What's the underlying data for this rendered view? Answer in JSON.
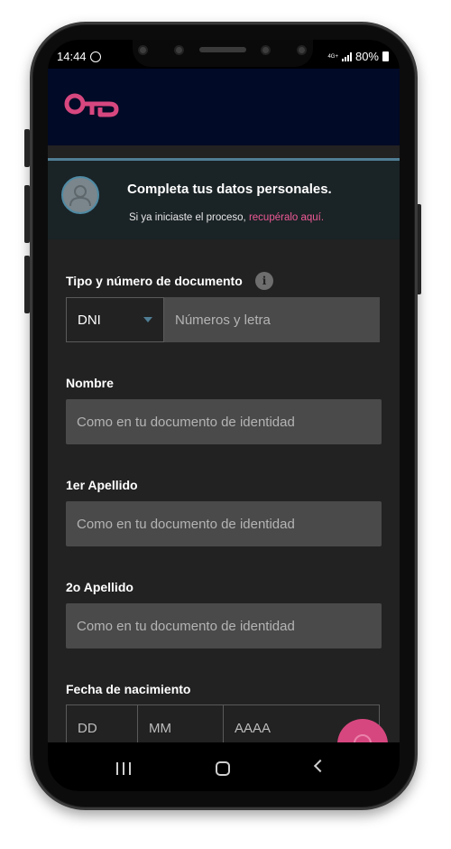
{
  "status": {
    "time": "14:44",
    "network": "4G+",
    "battery": "80%"
  },
  "colors": {
    "header_bg": "#010a26",
    "accent_pink": "#ee5a96",
    "logo": "#d7477f",
    "divider": "#4f7d94",
    "field_bg": "#4a4a4a"
  },
  "banner": {
    "title": "Completa tus datos personales.",
    "subtitle_prefix": "Si ya iniciaste el proceso, ",
    "link": "recupéralo aquí."
  },
  "form": {
    "document_label": "Tipo y número de documento",
    "info_icon_text": "i",
    "document_type": "DNI",
    "document_number_placeholder": "Números y letra",
    "name_label": "Nombre",
    "name_placeholder": "Como en tu documento de identidad",
    "surname1_label": "1er Apellido",
    "surname1_placeholder": "Como en tu documento de identidad",
    "surname2_label": "2o Apellido",
    "surname2_placeholder": "Como en tu documento de identidad",
    "birthdate_label": "Fecha de nacimiento",
    "day_placeholder": "DD",
    "month_placeholder": "MM",
    "year_placeholder": "AAAA"
  },
  "icons": {
    "whatsapp": "whatsapp-icon",
    "signal": "signal-icon",
    "battery": "battery-icon",
    "logo": "key-logo-icon",
    "avatar": "user-avatar-icon",
    "info": "info-icon",
    "dropdown": "chevron-down-icon",
    "fab": "chat-icon",
    "recent": "recent-apps-icon",
    "home": "home-icon",
    "back": "back-icon"
  }
}
